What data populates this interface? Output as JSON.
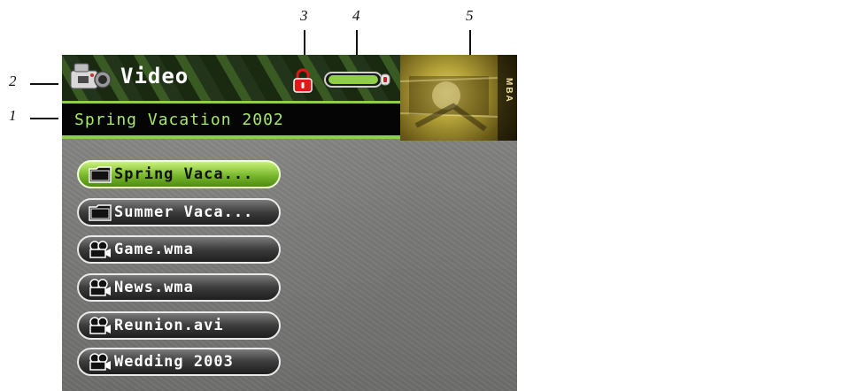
{
  "callouts": {
    "c1": "1",
    "c2": "2",
    "c3": "3",
    "c4": "4",
    "c5": "5"
  },
  "header": {
    "app_title": "Video",
    "app_icon": "video-camera-icon",
    "lock_icon": "lock-icon",
    "battery_icon": "battery-icon"
  },
  "album": {
    "title": "Spring Vacation 2002"
  },
  "thumbnail": {
    "side_label": "MBA"
  },
  "list": {
    "items": [
      {
        "label": "Spring Vaca...",
        "icon": "folder-icon",
        "selected": true
      },
      {
        "label": "Summer Vaca...",
        "icon": "folder-icon",
        "selected": false
      },
      {
        "label": "Game.wma",
        "icon": "video-file-icon",
        "selected": false
      },
      {
        "label": "News.wma",
        "icon": "video-file-icon",
        "selected": false
      },
      {
        "label": "Reunion.avi",
        "icon": "video-file-icon",
        "selected": false
      },
      {
        "label": "Wedding 2003",
        "icon": "video-file-icon",
        "selected": false
      }
    ]
  },
  "colors": {
    "accent_green": "#8fcf45",
    "selected_item": "#78b82c",
    "lock_red": "#e01818"
  }
}
